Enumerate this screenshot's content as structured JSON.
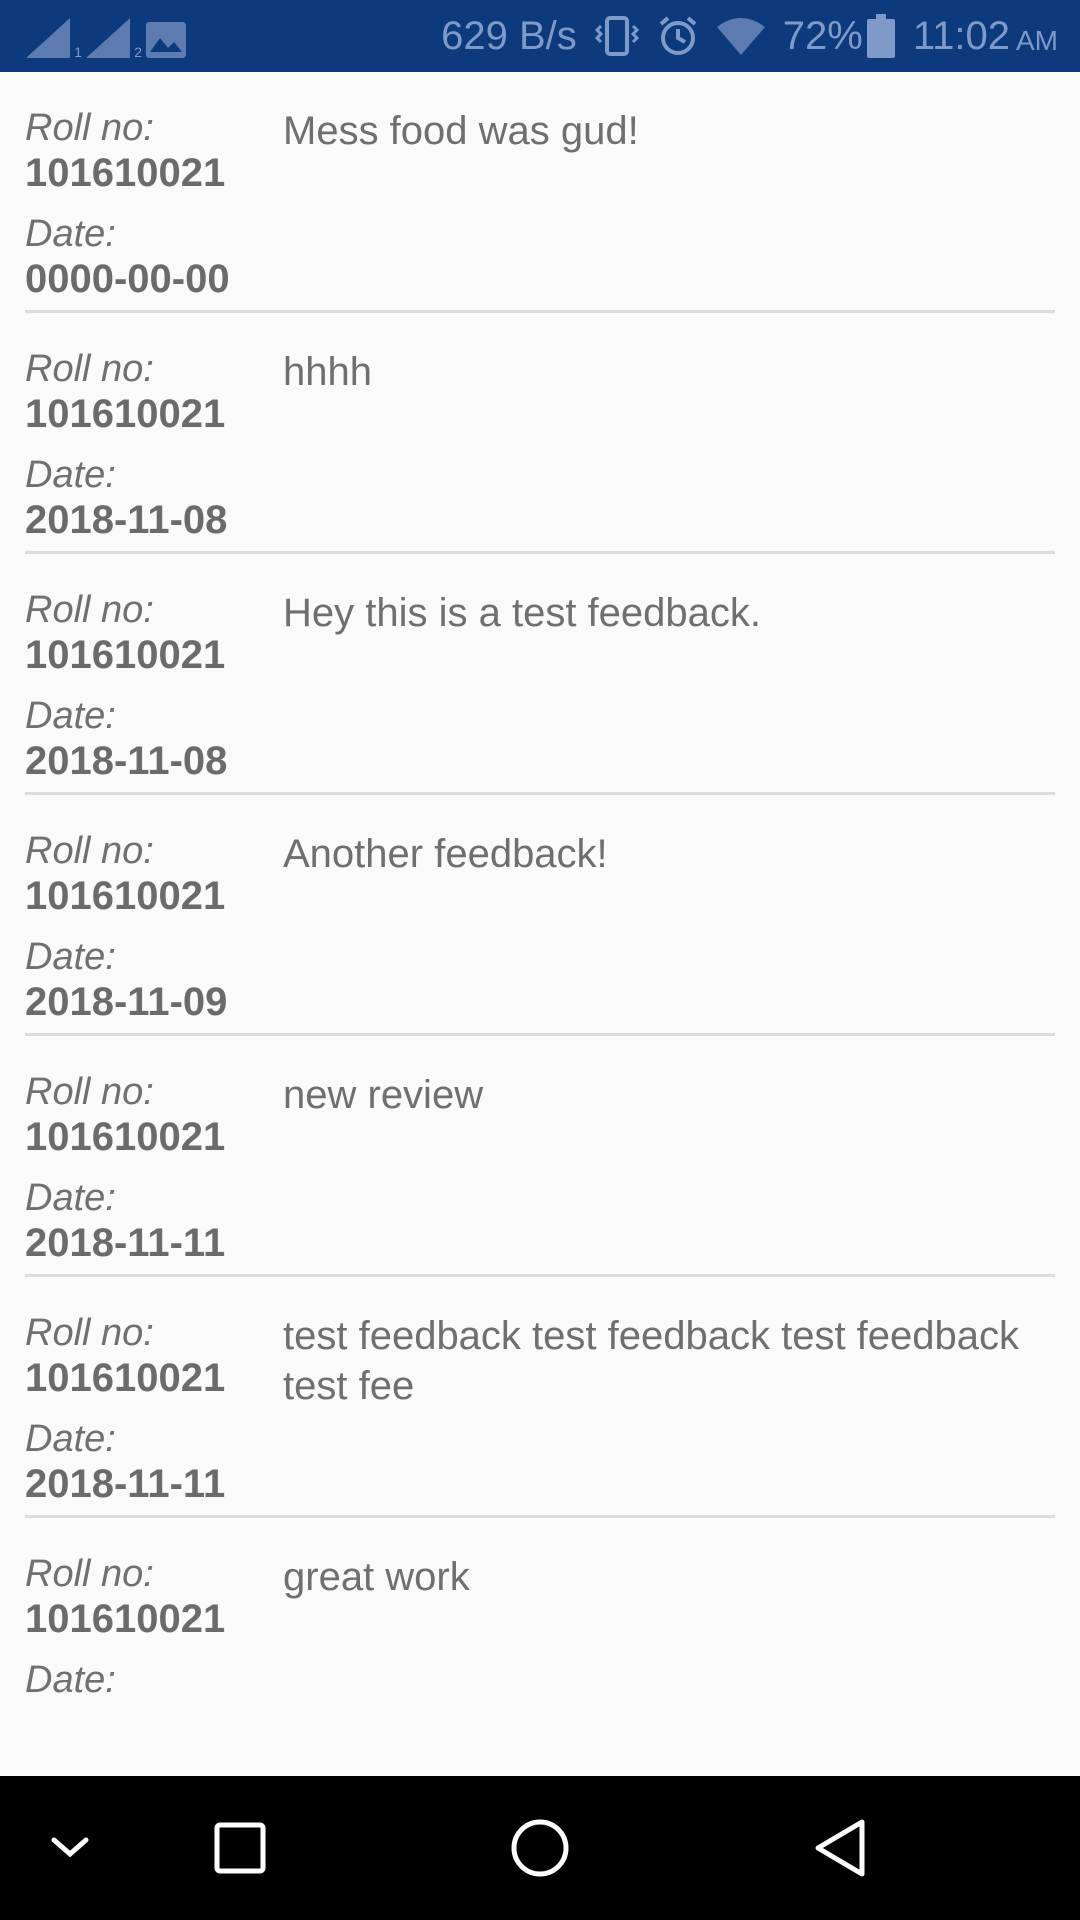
{
  "status_bar": {
    "sim1_label": "1",
    "sim2_label": "2",
    "net_speed": "629 B/s",
    "battery": "72%",
    "time": "11:02",
    "ampm": "AM",
    "icons": [
      "signal-icon",
      "signal-icon",
      "image-icon",
      "vibrate-icon",
      "alarm-icon",
      "wifi-icon",
      "battery-icon"
    ]
  },
  "labels": {
    "roll": "Roll no:",
    "date": "Date:"
  },
  "feedback_items": [
    {
      "roll": "101610021",
      "date": "0000-00-00",
      "text": "Mess food was gud!"
    },
    {
      "roll": "101610021",
      "date": "2018-11-08",
      "text": "hhhh"
    },
    {
      "roll": "101610021",
      "date": "2018-11-08",
      "text": "Hey this is a test feedback."
    },
    {
      "roll": "101610021",
      "date": "2018-11-09",
      "text": "Another feedback!"
    },
    {
      "roll": "101610021",
      "date": "2018-11-11",
      "text": "new review"
    },
    {
      "roll": "101610021",
      "date": "2018-11-11",
      "text": "test feedback test feedback test feedback test fee"
    },
    {
      "roll": "101610021",
      "date": "",
      "text": "great work"
    }
  ],
  "nav_bar": {
    "icons": [
      "chevron-down-icon",
      "recents-icon",
      "home-icon",
      "back-icon"
    ]
  }
}
